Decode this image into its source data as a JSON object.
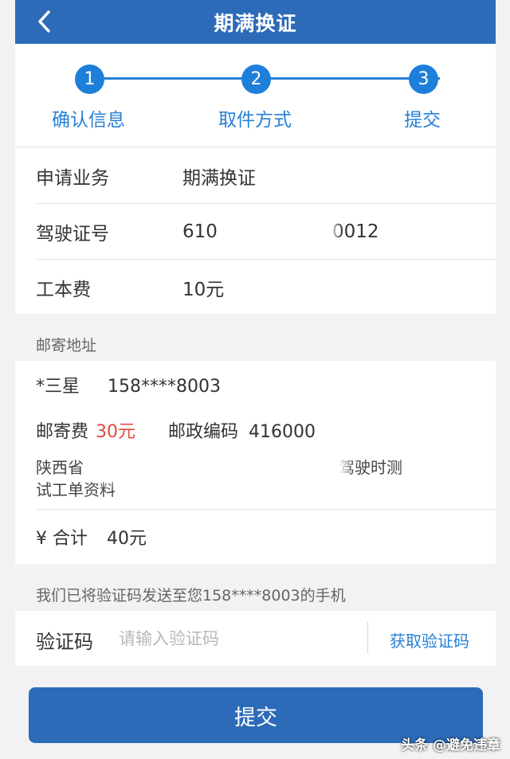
{
  "header": {
    "title": "期满换证"
  },
  "steps": [
    {
      "number": "1",
      "label": "确认信息"
    },
    {
      "number": "2",
      "label": "取件方式"
    },
    {
      "number": "3",
      "label": "提交"
    }
  ],
  "info": {
    "business_label": "申请业务",
    "business_value": "期满换证",
    "license_label": "驾驶证号",
    "license_prefix": "610",
    "license_suffix": "0012",
    "fee_label": "工本费",
    "fee_value": "10元"
  },
  "mail": {
    "section_label": "邮寄地址",
    "name": "*三星",
    "phone": "158****8003",
    "postage_label": "邮寄费",
    "postage_value": "30元",
    "postcode_label": "邮政编码",
    "postcode_value": "416000",
    "address_line1_start": "陕西省",
    "address_line1_end": "驾驶时测",
    "address_line2": "试工单资料"
  },
  "total": {
    "label": "¥ 合计",
    "value": "40元"
  },
  "verify": {
    "notice": "我们已将验证码发送至您158****8003的手机",
    "label": "验证码",
    "placeholder": "请输入验证码",
    "get_code": "获取验证码"
  },
  "submit_label": "提交",
  "watermark": "头条 @避免违章",
  "colors": {
    "primary": "#2d6bb8",
    "accent": "#1e7fdb",
    "price": "#e04a3f"
  }
}
